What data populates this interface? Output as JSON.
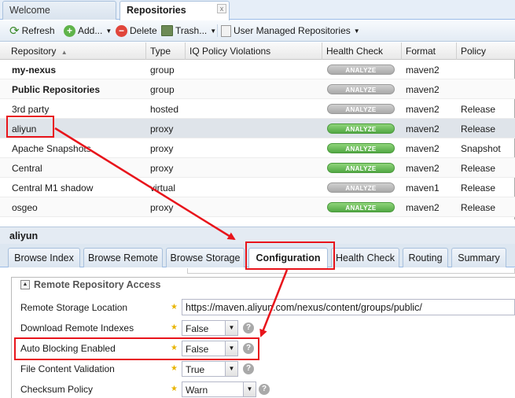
{
  "tabs": {
    "welcome": "Welcome",
    "repositories": "Repositories",
    "close": "x"
  },
  "toolbar": {
    "refresh": "Refresh",
    "add": "Add...",
    "delete": "Delete",
    "trash": "Trash...",
    "user_managed": "User Managed Repositories"
  },
  "grid": {
    "columns": {
      "repository": "Repository",
      "type": "Type",
      "iq": "IQ Policy Violations",
      "health": "Health Check",
      "format": "Format",
      "policy": "Policy"
    },
    "analyze_label": "ANALYZE",
    "rows": [
      {
        "name": "my-nexus",
        "type": "group",
        "analyze": "gray",
        "format": "maven2",
        "policy": ""
      },
      {
        "name": "Public Repositories",
        "type": "group",
        "analyze": "gray",
        "format": "maven2",
        "policy": ""
      },
      {
        "name": "3rd party",
        "type": "hosted",
        "analyze": "gray",
        "format": "maven2",
        "policy": "Release"
      },
      {
        "name": "aliyun",
        "type": "proxy",
        "analyze": "green",
        "format": "maven2",
        "policy": "Release"
      },
      {
        "name": "Apache Snapshots",
        "type": "proxy",
        "analyze": "green",
        "format": "maven2",
        "policy": "Snapshot"
      },
      {
        "name": "Central",
        "type": "proxy",
        "analyze": "green",
        "format": "maven2",
        "policy": "Release"
      },
      {
        "name": "Central M1 shadow",
        "type": "virtual",
        "analyze": "gray",
        "format": "maven1",
        "policy": "Release"
      },
      {
        "name": "osgeo",
        "type": "proxy",
        "analyze": "green",
        "format": "maven2",
        "policy": "Release"
      }
    ]
  },
  "detail": {
    "title": "aliyun",
    "tabs": [
      "Browse Index",
      "Browse Remote",
      "Browse Storage",
      "Configuration",
      "Health Check",
      "Routing",
      "Summary"
    ],
    "section": "Remote Repository Access",
    "fields": {
      "remote_storage_label": "Remote Storage Location",
      "remote_storage_value": "https://maven.aliyun.com/nexus/content/groups/public/",
      "download_indexes_label": "Download Remote Indexes",
      "download_indexes_value": "False",
      "auto_blocking_label": "Auto Blocking Enabled",
      "auto_blocking_value": "False",
      "file_validation_label": "File Content Validation",
      "file_validation_value": "True",
      "checksum_label": "Checksum Policy",
      "checksum_value": "Warn"
    }
  },
  "colors": {
    "annotation_red": "#e8141b",
    "analyze_green": "#52a844",
    "analyze_gray": "#a9a9a9",
    "selected_row": "#dfe4ea"
  }
}
